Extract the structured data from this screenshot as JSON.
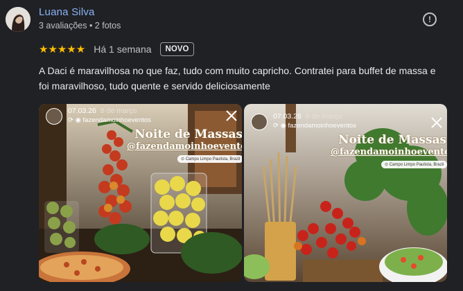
{
  "reviewer": {
    "name": "Luana Silva",
    "meta": "3 avaliações • 2 fotos"
  },
  "rating": {
    "stars": "★★★★★",
    "value": 5,
    "date": "Há 1 semana",
    "badge": "NOVO"
  },
  "review_text": "A Daci é maravilhosa no que faz, tudo com muito capricho. Contratei para buffet de massa e foi maravilhoso, tudo quente e servido deliciosamente",
  "photos": [
    {
      "date": "07.03.26",
      "date_label": "8 de março",
      "user": "fazendamoinhoeventos",
      "title": "Noite de Massas!",
      "handle": "@fazendamoinhoeventos",
      "location": "Campo Limpo Paulista, Brazil"
    },
    {
      "date": "07.03.26",
      "date_label": "8 de março",
      "user": "fazendamoinhoeventos",
      "title": "Noite de Massas!",
      "handle": "@fazendamoinhoeventos",
      "location": "Campo Limpo Paulista, Brazil"
    }
  ],
  "icons": {
    "report": "alert-circle-icon",
    "close": "close-icon",
    "star": "star-icon",
    "location": "location-pin-icon"
  },
  "colors": {
    "background": "#202124",
    "name_link": "#8ab4f8",
    "star": "#fbbc04",
    "text": "#e8eaed",
    "muted": "#bdc1c6"
  }
}
